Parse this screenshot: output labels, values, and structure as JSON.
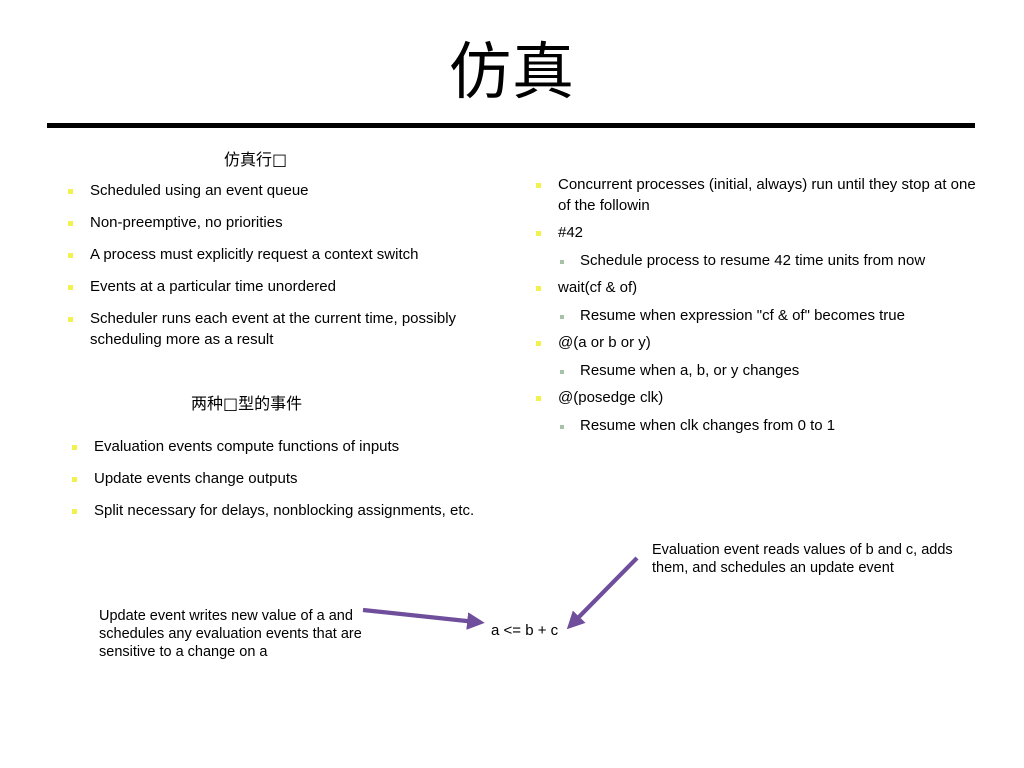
{
  "slide": {
    "title": "仿真",
    "background_color": "#ffffff",
    "rule_color": "#000000",
    "bullet_marker_color": "#F2F24D",
    "sub_bullet_marker_color": "#A7C3A7",
    "arrow_color": "#6F4E9C",
    "text_color": "#000000"
  },
  "left_column": {
    "heading_1": "仿真行□",
    "bullets_1": [
      "Scheduled using an event queue",
      "Non-preemptive, no priorities",
      "A process must explicitly request a context switch",
      "Events at a particular time unordered",
      "Scheduler runs each event at the current time, possibly scheduling more as a result"
    ],
    "heading_2": "两种□型的事件",
    "bullets_2": [
      "Evaluation events compute functions of inputs",
      "Update events change outputs",
      "Split necessary for delays, nonblocking assignments, etc."
    ]
  },
  "right_column": {
    "items": [
      {
        "text": "Concurrent processes (initial, always) run until they stop at one of the followin",
        "subs": []
      },
      {
        "text": "#42",
        "subs": [
          "Schedule process to resume 42 time units from now"
        ]
      },
      {
        "text": "wait(cf & of)",
        "subs": [
          "Resume when expression \"cf & of\" becomes true"
        ]
      },
      {
        "text": "@(a or b or y)",
        "subs": [
          "Resume when a, b, or y changes"
        ]
      },
      {
        "text": "@(posedge clk)",
        "subs": [
          "Resume when clk changes from 0 to 1"
        ]
      }
    ]
  },
  "diagram": {
    "code_expression": "a <= b + c",
    "callout_left": "Update event writes new value of a and schedules any evaluation events that are sensitive to a change on  a",
    "callout_right": "Evaluation event reads values of b and c, adds them, and schedules an update event"
  }
}
